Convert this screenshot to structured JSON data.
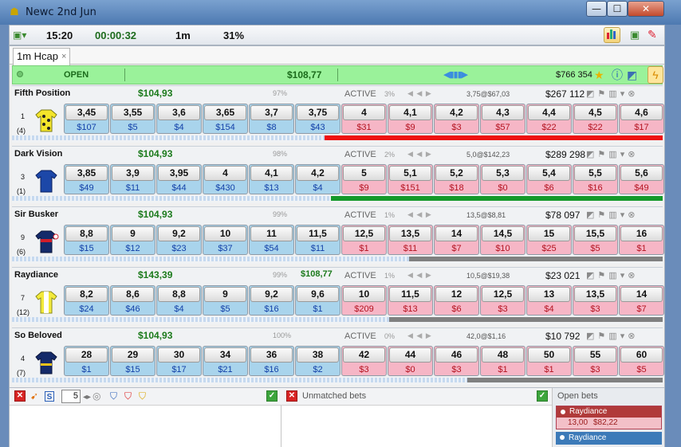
{
  "window": {
    "title": "Newc 2nd Jun",
    "minimize": "—",
    "maximize": "☐",
    "close": "✕"
  },
  "toolbar": {
    "time": "15:20",
    "elapsed": "00:00:32",
    "interval": "1m",
    "percent": "31%"
  },
  "tab": {
    "label": "1m Hcap",
    "close": "×"
  },
  "market": {
    "status": "OPEN",
    "matched": "$108,77",
    "total": "$766 354"
  },
  "runners": [
    {
      "name": "Fifth Position",
      "pl": "$104,93",
      "pct": "97%",
      "extra": "",
      "active": "ACTIVE",
      "active_pct": "3%",
      "last": "3,75@$67,03",
      "volume": "$267 112",
      "number": "1",
      "draw": "(4)",
      "back": [
        [
          "3,45",
          "$107"
        ],
        [
          "3,55",
          "$5"
        ],
        [
          "3,6",
          "$4"
        ],
        [
          "3,65",
          "$154"
        ],
        [
          "3,7",
          "$8"
        ],
        [
          "3,75",
          "$43"
        ]
      ],
      "lay": [
        [
          "4",
          "$31"
        ],
        [
          "4,1",
          "$9"
        ],
        [
          "4,2",
          "$3"
        ],
        [
          "4,3",
          "$57"
        ],
        [
          "4,4",
          "$22"
        ],
        [
          "4,5",
          "$22"
        ],
        [
          "4,6",
          "$17"
        ]
      ],
      "bar_color": "#ee1111",
      "bar_start": 0.48,
      "bar_end": 1.0,
      "silk": "yellow-spots"
    },
    {
      "name": "Dark Vision",
      "pl": "$104,93",
      "pct": "98%",
      "extra": "",
      "active": "ACTIVE",
      "active_pct": "2%",
      "last": "5,0@$142,23",
      "volume": "$289 298",
      "number": "3",
      "draw": "(1)",
      "back": [
        [
          "3,85",
          "$49"
        ],
        [
          "3,9",
          "$11"
        ],
        [
          "3,95",
          "$44"
        ],
        [
          "4",
          "$430"
        ],
        [
          "4,1",
          "$13"
        ],
        [
          "4,2",
          "$4"
        ]
      ],
      "lay": [
        [
          "5",
          "$9"
        ],
        [
          "5,1",
          "$151"
        ],
        [
          "5,2",
          "$18"
        ],
        [
          "5,3",
          "$0"
        ],
        [
          "5,4",
          "$6"
        ],
        [
          "5,5",
          "$16"
        ],
        [
          "5,6",
          "$49"
        ]
      ],
      "bar_color": "#14992a",
      "bar_start": 0.49,
      "bar_end": 1.0,
      "silk": "blue"
    },
    {
      "name": "Sir Busker",
      "pl": "$104,93",
      "pct": "99%",
      "extra": "",
      "active": "ACTIVE",
      "active_pct": "1%",
      "last": "13,5@$8,81",
      "volume": "$78 097",
      "number": "9",
      "draw": "(6)",
      "back": [
        [
          "8,8",
          "$15"
        ],
        [
          "9",
          "$12"
        ],
        [
          "9,2",
          "$23"
        ],
        [
          "10",
          "$37"
        ],
        [
          "11",
          "$54"
        ],
        [
          "11,5",
          "$11"
        ]
      ],
      "lay": [
        [
          "12,5",
          "$1"
        ],
        [
          "13,5",
          "$11"
        ],
        [
          "14",
          "$7"
        ],
        [
          "14,5",
          "$10"
        ],
        [
          "15",
          "$25"
        ],
        [
          "15,5",
          "$5"
        ],
        [
          "16",
          "$1"
        ]
      ],
      "bar_color": "#808080",
      "bar_start": 0.61,
      "bar_end": 1.0,
      "silk": "navy-red"
    },
    {
      "name": "Raydiance",
      "pl": "$143,39",
      "pct": "99%",
      "extra": "$108,77",
      "active": "ACTIVE",
      "active_pct": "1%",
      "last": "10,5@$19,38",
      "volume": "$23 021",
      "number": "7",
      "draw": "(12)",
      "back": [
        [
          "8,2",
          "$24"
        ],
        [
          "8,6",
          "$46"
        ],
        [
          "8,8",
          "$4"
        ],
        [
          "9",
          "$5"
        ],
        [
          "9,2",
          "$16"
        ],
        [
          "9,6",
          "$1"
        ]
      ],
      "lay": [
        [
          "10",
          "$209"
        ],
        [
          "11,5",
          "$13"
        ],
        [
          "12",
          "$6"
        ],
        [
          "12,5",
          "$3"
        ],
        [
          "13",
          "$4"
        ],
        [
          "13,5",
          "$3"
        ],
        [
          "14",
          "$7"
        ]
      ],
      "bar_color": "#808080",
      "bar_start": 0.58,
      "bar_end": 1.0,
      "silk": "yellow-white"
    },
    {
      "name": "So Beloved",
      "pl": "$104,93",
      "pct": "100%",
      "extra": "",
      "active": "ACTIVE",
      "active_pct": "0%",
      "last": "42,0@$1,16",
      "volume": "$10 792",
      "number": "4",
      "draw": "(7)",
      "back": [
        [
          "28",
          "$1"
        ],
        [
          "29",
          "$15"
        ],
        [
          "30",
          "$17"
        ],
        [
          "34",
          "$21"
        ],
        [
          "36",
          "$16"
        ],
        [
          "38",
          "$2"
        ]
      ],
      "lay": [
        [
          "42",
          "$3"
        ],
        [
          "44",
          "$0"
        ],
        [
          "46",
          "$3"
        ],
        [
          "48",
          "$1"
        ],
        [
          "50",
          "$1"
        ],
        [
          "55",
          "$3"
        ],
        [
          "60",
          "$5"
        ]
      ],
      "bar_color": "#808080",
      "bar_start": 0.7,
      "bar_end": 1.0,
      "silk": "navy-yellow"
    }
  ],
  "bets_panel": {
    "stake": "5",
    "unmatched_label": "Unmatched bets",
    "open_label": "Open bets"
  },
  "open_bets": [
    {
      "runner": "Raydiance",
      "odds": "13,00",
      "stake": "$82,22",
      "side": "lay",
      "color": "#b03a3a"
    },
    {
      "runner": "Raydiance",
      "side": "back",
      "color": "#3c7ab8"
    }
  ]
}
